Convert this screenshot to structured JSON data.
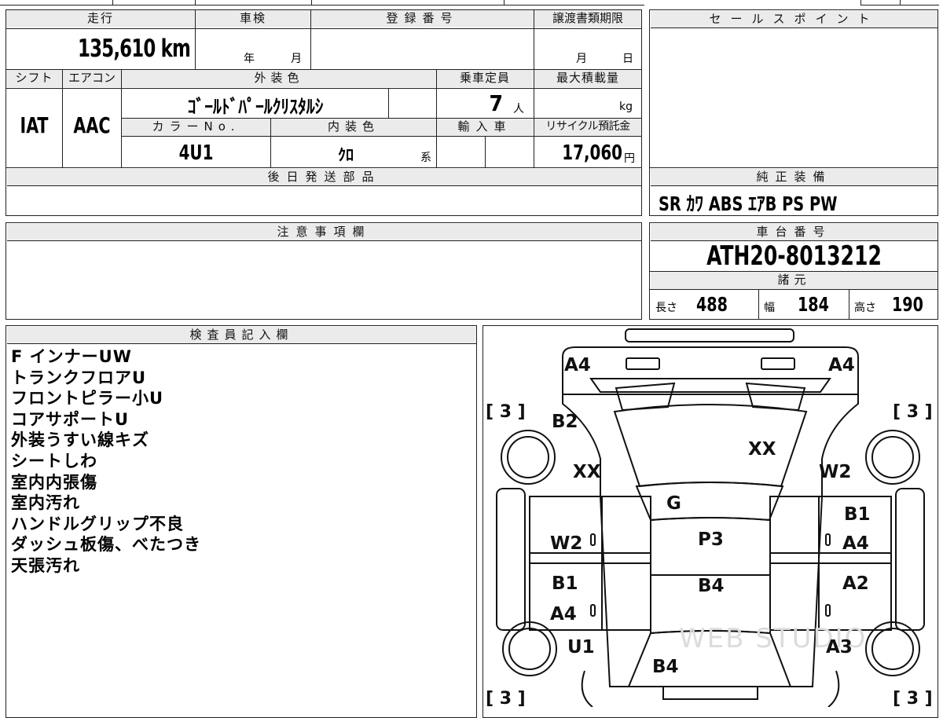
{
  "top": {
    "mileage_header": "走行",
    "mileage_value": "135,610 km",
    "inspection_header": "車検",
    "inspection_year": "年",
    "inspection_month": "月",
    "registration_header": "登録番号",
    "transfer_header": "譲渡書類期限",
    "transfer_month": "月",
    "transfer_day": "日"
  },
  "spec": {
    "shift_header": "シフト",
    "shift_value": "IAT",
    "aircon_header": "エアコン",
    "aircon_value": "AAC",
    "exterior_header": "外装色",
    "exterior_value": "ｺﾞｰﾙﾄﾞﾊﾟｰﾙｸﾘｽﾀﾙｼ",
    "capacity_header": "乗車定員",
    "capacity_value": "7",
    "capacity_unit": "人",
    "max_load_header": "最大積載量",
    "max_load_unit": "kg",
    "color_no_header": "カラーNo.",
    "color_no_value": "4U1",
    "interior_header": "内装色",
    "interior_value": "ｸﾛ",
    "interior_suffix": "系",
    "import_header": "輸入車",
    "recycle_header": "リサイクル預託金",
    "recycle_value": "17,060",
    "recycle_unit": "円"
  },
  "later_parts": {
    "header": "後日発送部品"
  },
  "sales_point": {
    "header": "セールスポイント"
  },
  "genuine_equipment": {
    "header": "純正装備",
    "value": "SR ｶﾜ ABS ｴｱB PS PW"
  },
  "caution": {
    "header": "注意事項欄"
  },
  "chassis": {
    "header": "車台番号",
    "value": "ATH20-8013212"
  },
  "dimensions": {
    "header": "諸元",
    "length_label": "長さ",
    "length_value": "488",
    "width_label": "幅",
    "width_value": "184",
    "height_label": "高さ",
    "height_value": "190"
  },
  "inspector": {
    "header": "検査員記入欄",
    "notes": [
      "F インナーUW",
      "トランクフロアU",
      "フロントピラー小U",
      "コアサポートU",
      "外装うすい線キズ",
      "シートしわ",
      "室内内張傷",
      "室内汚れ",
      "ハンドルグリップ不良",
      "ダッシュ板傷、べたつき",
      "天張汚れ"
    ]
  },
  "diagram": {
    "tire_label": "[ 3 ]",
    "marks": {
      "front_left_corner": "A4",
      "front_right_corner": "A4",
      "left_front_fender": "B2",
      "left_front_fender_2": "XX",
      "hood": "XX",
      "right_front_fender": "W2",
      "windshield": "G",
      "left_front_door": "W2",
      "right_front_door_1": "B1",
      "right_front_door_2": "A4",
      "roof": "P3",
      "left_rear_door_1": "B1",
      "left_rear_door_2": "A4",
      "right_rear_door": "A2",
      "rear_roof": "B4",
      "left_quarter": "U1",
      "right_quarter": "A3",
      "back_door": "B4"
    },
    "watermark": "WEB STUDIO"
  }
}
